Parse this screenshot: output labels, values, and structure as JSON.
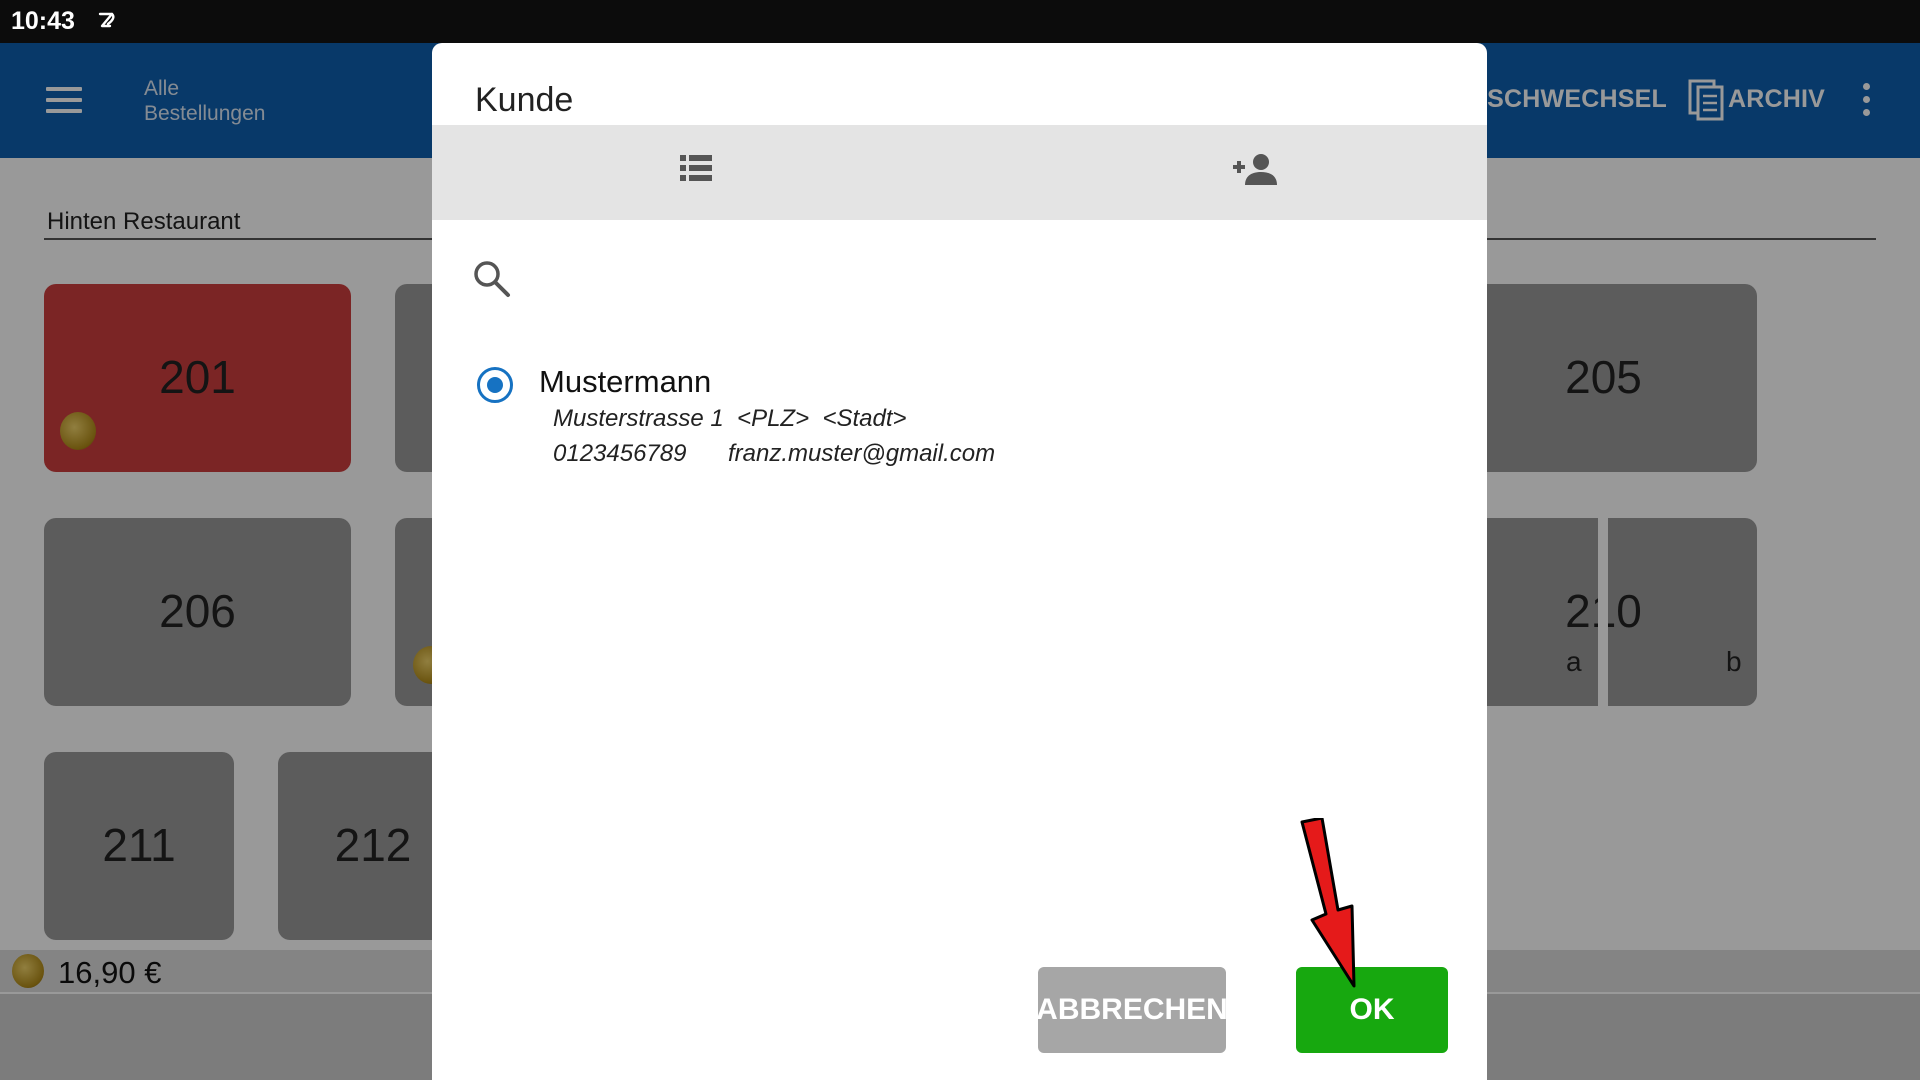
{
  "status_bar": {
    "time": "10:43",
    "notification_icon": "pen-swirl-icon"
  },
  "app_bar": {
    "nav_title_line1": "Alle",
    "nav_title_line2": "Bestellungen",
    "action_tischwechsel": "ISCHWECHSEL",
    "action_archiv": "ARCHIV",
    "color": "#0e5fb0"
  },
  "main": {
    "room": "Hinten Restaurant",
    "tables": [
      {
        "label": "201",
        "state": "occupied",
        "color": "#ce3f3f"
      },
      {
        "label": "205"
      },
      {
        "label": "206"
      },
      {
        "label": "210",
        "sub_a": "a",
        "sub_b": "b"
      },
      {
        "label": "211"
      },
      {
        "label": "212"
      }
    ],
    "total": "16,90 €"
  },
  "dialog": {
    "title": "Kunde",
    "tabs": [
      {
        "icon": "list-icon",
        "selected": true
      },
      {
        "icon": "add-person-icon",
        "selected": false
      }
    ],
    "search": {
      "icon": "search-icon",
      "value": ""
    },
    "customer": {
      "name": "Mustermann",
      "address": "Musterstrasse 1  <PLZ>  <Stadt>",
      "phone": "0123456789",
      "email": "franz.muster@gmail.com",
      "selected": true
    },
    "cancel_label": "ABBRECHEN",
    "ok_label": "OK",
    "ok_color": "#17a80f"
  }
}
